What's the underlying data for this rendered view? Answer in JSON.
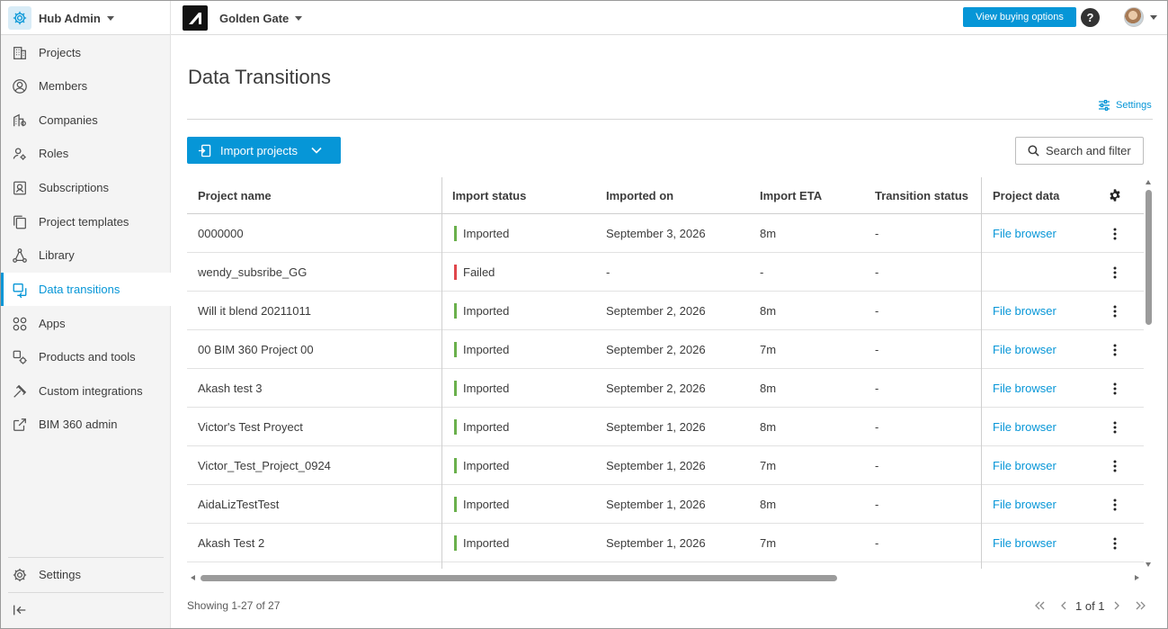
{
  "header": {
    "hub_title": "Hub Admin",
    "project_title": "Golden Gate",
    "buy_label": "View buying options",
    "help_label": "?"
  },
  "sidebar": {
    "items": [
      {
        "label": "Projects",
        "icon": "building-icon"
      },
      {
        "label": "Members",
        "icon": "user-circle-icon"
      },
      {
        "label": "Companies",
        "icon": "companies-icon"
      },
      {
        "label": "Roles",
        "icon": "roles-icon"
      },
      {
        "label": "Subscriptions",
        "icon": "subscription-icon"
      },
      {
        "label": "Project templates",
        "icon": "templates-icon"
      },
      {
        "label": "Library",
        "icon": "library-icon"
      },
      {
        "label": "Data transitions",
        "icon": "data-transitions-icon",
        "active": true
      },
      {
        "label": "Apps",
        "icon": "apps-grid-icon"
      },
      {
        "label": "Products and tools",
        "icon": "products-tools-icon"
      },
      {
        "label": "Custom integrations",
        "icon": "integrations-icon"
      },
      {
        "label": "BIM 360 admin",
        "icon": "external-link-icon"
      }
    ],
    "settings_label": "Settings",
    "collapse_icon": "collapse-sidebar-icon"
  },
  "main": {
    "title": "Data Transitions",
    "settings_label": "Settings",
    "import_label": "Import projects",
    "search_label": "Search and filter"
  },
  "table": {
    "columns": [
      "Project name",
      "Import status",
      "Imported on",
      "Import ETA",
      "Transition status",
      "Project data"
    ],
    "rows": [
      {
        "name": "0000000",
        "status": "Imported",
        "imported_on": "September 3, 2026",
        "eta": "8m",
        "transition": "-",
        "data": "File browser"
      },
      {
        "name": "wendy_subsribe_GG",
        "status": "Failed",
        "imported_on": "-",
        "eta": "-",
        "transition": "-",
        "data": ""
      },
      {
        "name": "Will it blend 20211011",
        "status": "Imported",
        "imported_on": "September 2, 2026",
        "eta": "8m",
        "transition": "-",
        "data": "File browser"
      },
      {
        "name": "00 BIM 360 Project 00",
        "status": "Imported",
        "imported_on": "September 2, 2026",
        "eta": "7m",
        "transition": "-",
        "data": "File browser"
      },
      {
        "name": "Akash test 3",
        "status": "Imported",
        "imported_on": "September 2, 2026",
        "eta": "8m",
        "transition": "-",
        "data": "File browser"
      },
      {
        "name": "Victor's Test Proyect",
        "status": "Imported",
        "imported_on": "September 1, 2026",
        "eta": "8m",
        "transition": "-",
        "data": "File browser"
      },
      {
        "name": "Victor_Test_Project_0924",
        "status": "Imported",
        "imported_on": "September 1, 2026",
        "eta": "7m",
        "transition": "-",
        "data": "File browser"
      },
      {
        "name": "AidaLizTestTest",
        "status": "Imported",
        "imported_on": "September 1, 2026",
        "eta": "8m",
        "transition": "-",
        "data": "File browser"
      },
      {
        "name": "Akash Test 2",
        "status": "Imported",
        "imported_on": "September 1, 2026",
        "eta": "7m",
        "transition": "-",
        "data": "File browser"
      }
    ]
  },
  "footer": {
    "count_text": "Showing 1-27 of 27",
    "page_text": "1 of 1"
  },
  "colors": {
    "accent": "#0696d7",
    "imported": "#6ab04c",
    "failed": "#e0474c"
  }
}
